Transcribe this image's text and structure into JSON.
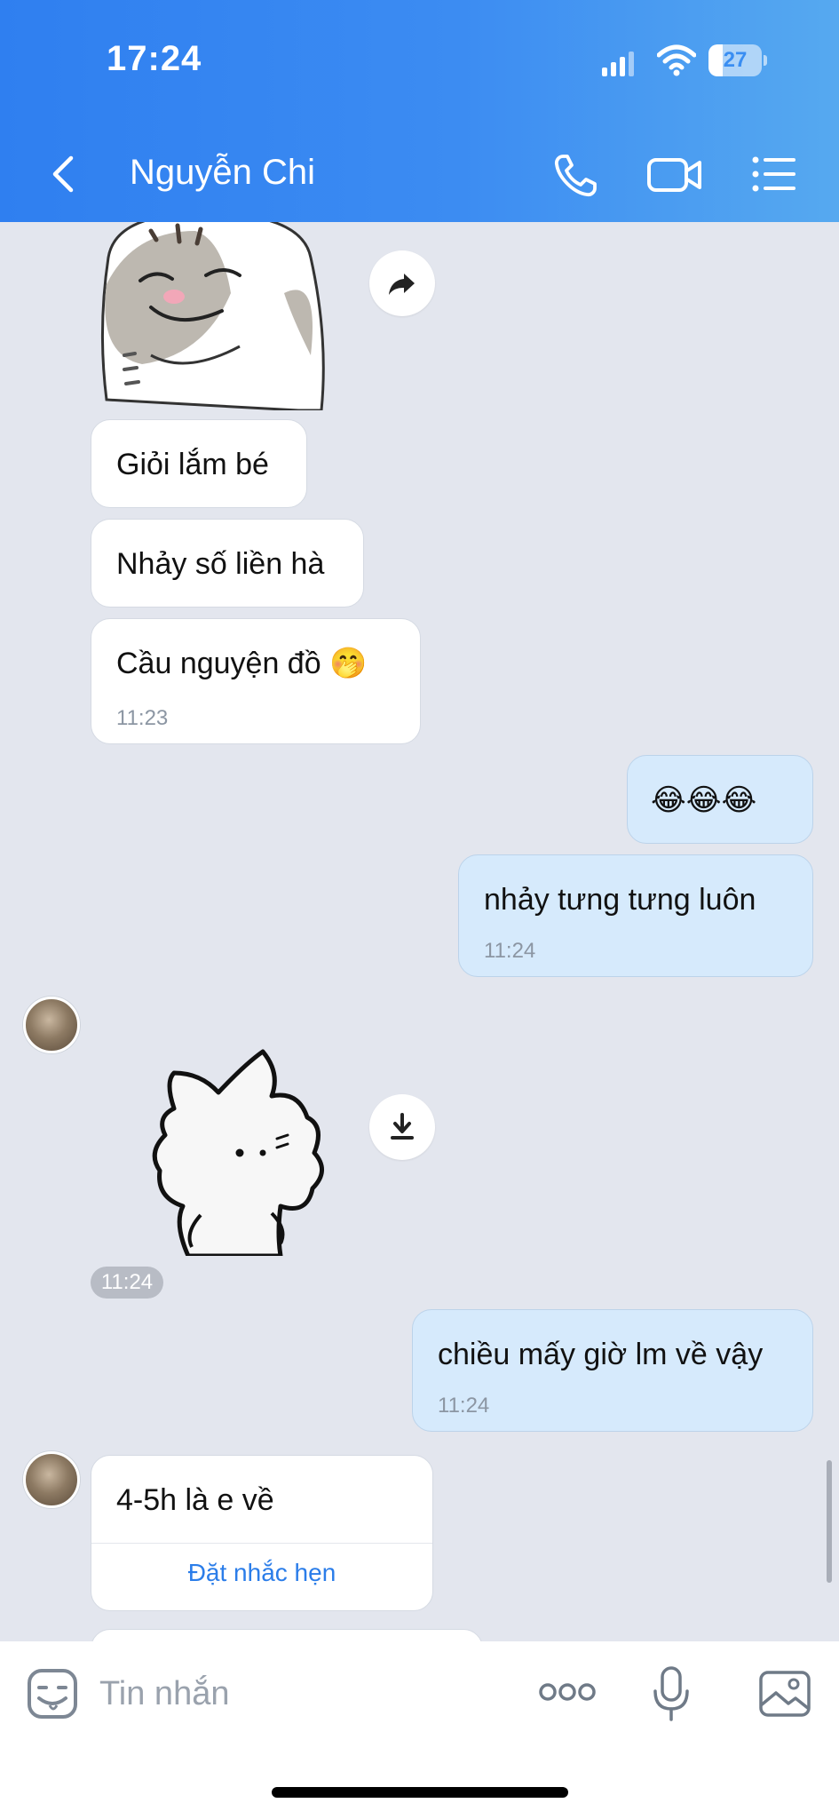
{
  "status_bar": {
    "time": "17:24",
    "battery": "27",
    "battery_level": 0.27
  },
  "header": {
    "contact_name": "Nguyễn Chi"
  },
  "messages": [
    {
      "type": "sticker",
      "direction": "in",
      "name": "cat-smirk-sticker"
    },
    {
      "type": "text",
      "direction": "in",
      "text": "Giỏi lắm bé"
    },
    {
      "type": "text",
      "direction": "in",
      "text": "Nhảy số liền hà"
    },
    {
      "type": "text",
      "direction": "in",
      "text": "Cầu nguyện đồ 🤭",
      "time": "11:23"
    },
    {
      "type": "text",
      "direction": "out",
      "text": "😂😂😂"
    },
    {
      "type": "text",
      "direction": "out",
      "text": "nhảy tưng tưng luôn",
      "time": "11:24"
    },
    {
      "type": "sticker",
      "direction": "in",
      "name": "white-cat-sticker",
      "time": "11:24"
    },
    {
      "type": "text",
      "direction": "out",
      "text": "chiều mấy giờ lm về vậy",
      "time": "11:24"
    },
    {
      "type": "text",
      "direction": "in",
      "text": "4-5h là e về",
      "action": "Đặt nhắc hẹn"
    }
  ],
  "input": {
    "placeholder": "Tin nhắn"
  },
  "colors": {
    "header_start": "#2f7ff0",
    "header_end": "#56a9f0",
    "outgoing_bubble": "#d6eafc",
    "incoming_bubble": "#ffffff",
    "link": "#2b7de9"
  }
}
